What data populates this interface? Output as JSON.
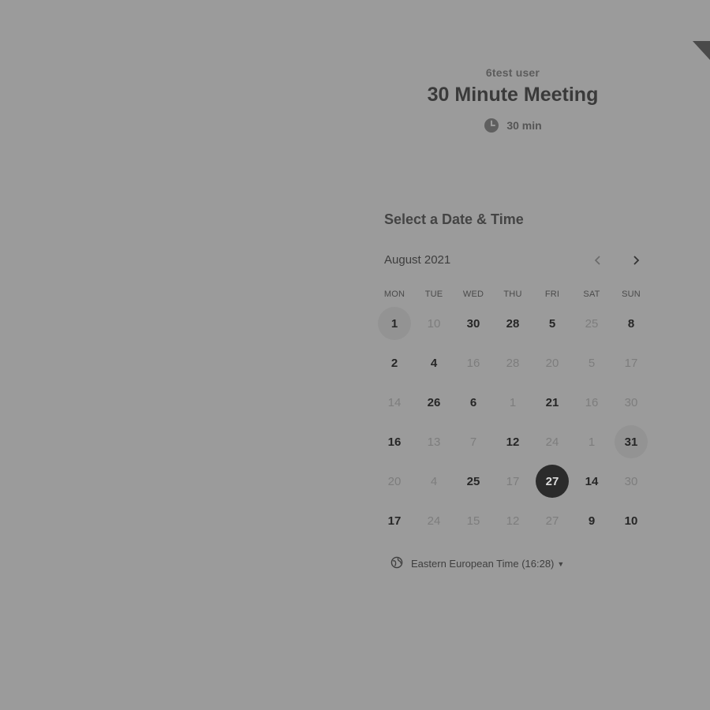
{
  "header": {
    "organizer": "6test user",
    "event_title": "30 Minute Meeting",
    "duration": "30 min",
    "duration_icon": "clock-icon"
  },
  "picker": {
    "section_title": "Select a Date & Time",
    "month_label": "August 2021",
    "prev_icon": "chevron-left-icon",
    "next_icon": "chevron-right-icon",
    "weekdays": [
      "MON",
      "TUE",
      "WED",
      "THU",
      "FRI",
      "SAT",
      "SUN"
    ],
    "weeks": [
      [
        {
          "label": "1",
          "available": true,
          "highlighted": true
        },
        {
          "label": "10",
          "available": false
        },
        {
          "label": "30",
          "available": true
        },
        {
          "label": "28",
          "available": true
        },
        {
          "label": "5",
          "available": true
        },
        {
          "label": "25",
          "available": false
        },
        {
          "label": "8",
          "available": true
        }
      ],
      [
        {
          "label": "2",
          "available": true
        },
        {
          "label": "4",
          "available": true
        },
        {
          "label": "16",
          "available": false
        },
        {
          "label": "28",
          "available": false
        },
        {
          "label": "20",
          "available": false
        },
        {
          "label": "5",
          "available": false
        },
        {
          "label": "17",
          "available": false
        }
      ],
      [
        {
          "label": "14",
          "available": false
        },
        {
          "label": "26",
          "available": true
        },
        {
          "label": "6",
          "available": true
        },
        {
          "label": "1",
          "available": false
        },
        {
          "label": "21",
          "available": true
        },
        {
          "label": "16",
          "available": false
        },
        {
          "label": "30",
          "available": false
        }
      ],
      [
        {
          "label": "16",
          "available": true
        },
        {
          "label": "13",
          "available": false
        },
        {
          "label": "7",
          "available": false
        },
        {
          "label": "12",
          "available": true
        },
        {
          "label": "24",
          "available": false
        },
        {
          "label": "1",
          "available": false
        },
        {
          "label": "31",
          "available": true,
          "highlighted": true
        }
      ],
      [
        {
          "label": "20",
          "available": false
        },
        {
          "label": "4",
          "available": false
        },
        {
          "label": "25",
          "available": true
        },
        {
          "label": "17",
          "available": false
        },
        {
          "label": "27",
          "available": true,
          "selected": true
        },
        {
          "label": "14",
          "available": true
        },
        {
          "label": "30",
          "available": false
        }
      ],
      [
        {
          "label": "17",
          "available": true
        },
        {
          "label": "24",
          "available": false
        },
        {
          "label": "15",
          "available": false
        },
        {
          "label": "12",
          "available": false
        },
        {
          "label": "27",
          "available": false
        },
        {
          "label": "9",
          "available": true
        },
        {
          "label": "10",
          "available": true
        }
      ]
    ],
    "timezone": {
      "label": "Eastern European Time (16:28)",
      "icon": "globe-icon",
      "caret_icon": "caret-down-icon"
    }
  },
  "colors": {
    "overlay_background": "#9b9b9b",
    "selected_day": "#2b2b2b",
    "highlight_day": "#939393"
  }
}
